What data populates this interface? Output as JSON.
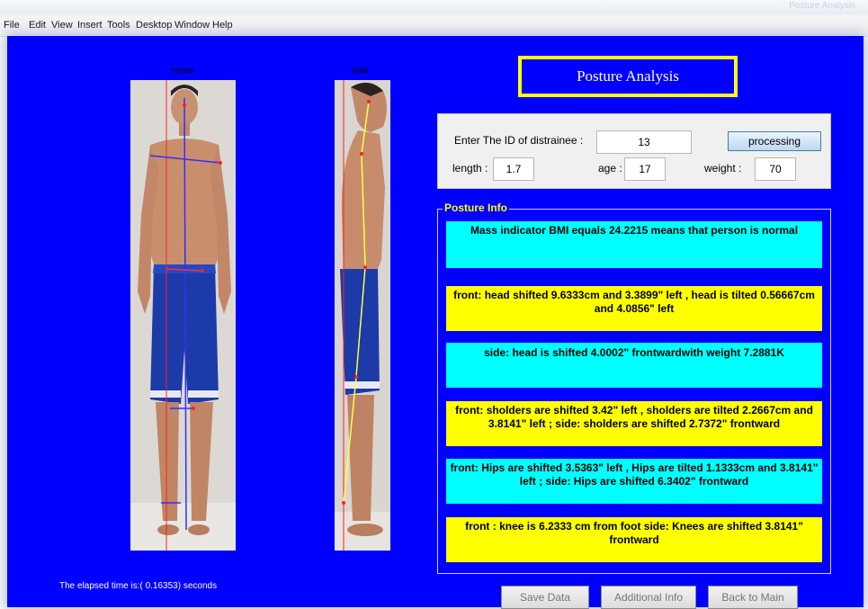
{
  "window": {
    "title": "Posture Analysis"
  },
  "menu": [
    "File",
    "Edit",
    "View",
    "Insert",
    "Tools",
    "Desktop",
    "Window",
    "Help"
  ],
  "images": {
    "front_label": "frontal",
    "side_label": "sidal"
  },
  "app_title": "Posture Analysis",
  "form": {
    "id_label": "Enter The ID of distrainee :",
    "id_value": "13",
    "process_button": "processing",
    "length_label": "length :",
    "length_value": "1.7",
    "age_label": "age :",
    "age_value": "17",
    "weight_label": "weight :",
    "weight_value": "70"
  },
  "posture_info": {
    "title": "Posture Info",
    "items": [
      "Mass indicator BMI equals 24.2215 means that person is normal",
      "front: head shifted   9.6333cm and 3.3899\"   left , head is tilted   0.56667cm and 4.0856\"   left",
      "side: head is shifted 4.0002\"   frontwardwith weight 7.2881K",
      "front: sholders are shifted  3.42\"  left ,  sholders are tilted  2.2667cm and 3.8141\"   left ;  side: sholders are shifted 2.7372\"   frontward",
      "front: Hips are shifted  3.5363\"   left ,  Hips are tilted  1.1333cm and 3.8141\"   left ; side:  Hips are  shifted 6.3402\" frontward",
      "front : knee is 6.2333 cm from foot     side:  Knees are  shifted 3.8141\"   frontward"
    ]
  },
  "elapsed_text": "The elapsed time is:( 0.16353) seconds",
  "buttons": {
    "save": "Save Data",
    "additional": "Additional Info",
    "back": "Back to Main"
  },
  "colors": {
    "background": "#0000ff",
    "accent_yellow": "#ffff00",
    "accent_cyan": "#00ffff"
  }
}
